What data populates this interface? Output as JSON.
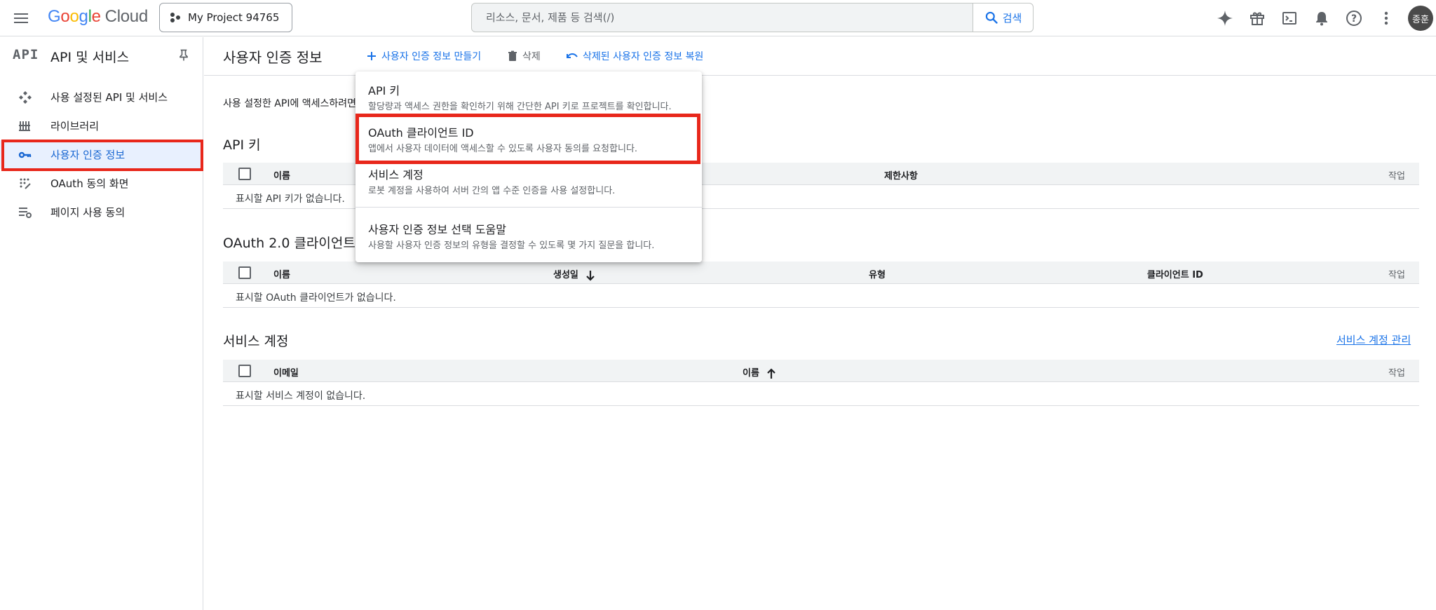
{
  "header": {
    "logo_google": [
      "G",
      "o",
      "o",
      "g",
      "l",
      "e"
    ],
    "logo_cloud": "Cloud",
    "project_name": "My Project 94765",
    "search_placeholder": "리소스, 문서, 제품 등 검색(/)",
    "search_button": "검색",
    "avatar_text": "종훈",
    "icons": [
      "gemini-sparkle-icon",
      "gift-icon",
      "cloud-shell-icon",
      "notifications-icon",
      "help-icon",
      "more-vert-icon"
    ]
  },
  "sidebar": {
    "logo": "API",
    "title": "API 및 서비스",
    "items": [
      {
        "label": "사용 설정된 API 및 서비스",
        "icon": "enabled-apis-icon"
      },
      {
        "label": "라이브러리",
        "icon": "library-icon"
      },
      {
        "label": "사용자 인증 정보",
        "icon": "key-icon",
        "active": true
      },
      {
        "label": "OAuth 동의 화면",
        "icon": "oauth-consent-icon"
      },
      {
        "label": "페이지 사용 동의",
        "icon": "page-usage-icon"
      }
    ]
  },
  "main": {
    "title": "사용자 인증 정보",
    "actions": {
      "create": "사용자 인증 정보 만들기",
      "delete": "삭제",
      "restore": "삭제된 사용자 인증 정보 복원"
    },
    "description": "사용 설정한 API에 액세스하려면",
    "api_keys": {
      "title": "API 키",
      "columns": [
        "이름",
        "제한사항",
        "작업"
      ],
      "empty": "표시할 API 키가 없습니다."
    },
    "oauth": {
      "title": "OAuth 2.0 클라이언트",
      "columns": [
        "이름",
        "생성일",
        "유형",
        "클라이언트 ID",
        "작업"
      ],
      "empty": "표시할 OAuth 클라이언트가 없습니다."
    },
    "service_accounts": {
      "title": "서비스 계정",
      "manage_link": "서비스 계정 관리",
      "columns": [
        "이메일",
        "이름",
        "작업"
      ],
      "empty": "표시할 서비스 계정이 없습니다."
    }
  },
  "dropdown": {
    "items": [
      {
        "title": "API 키",
        "desc": "할당량과 액세스 권한을 확인하기 위해 간단한 API 키로 프로젝트를 확인합니다."
      },
      {
        "title": "OAuth 클라이언트 ID",
        "desc": "앱에서 사용자 데이터에 액세스할 수 있도록 사용자 동의를 요청합니다."
      },
      {
        "title": "서비스 계정",
        "desc": "로봇 계정을 사용하여 서버 간의 앱 수준 인증을 사용 설정합니다."
      },
      {
        "title": "사용자 인증 정보 선택 도움말",
        "desc": "사용할 사용자 인증 정보의 유형을 결정할 수 있도록 몇 가지 질문을 합니다."
      }
    ]
  },
  "colors": {
    "accent": "#1a73e8",
    "highlight": "#e8271b",
    "active_bg": "#e8f0fe"
  }
}
